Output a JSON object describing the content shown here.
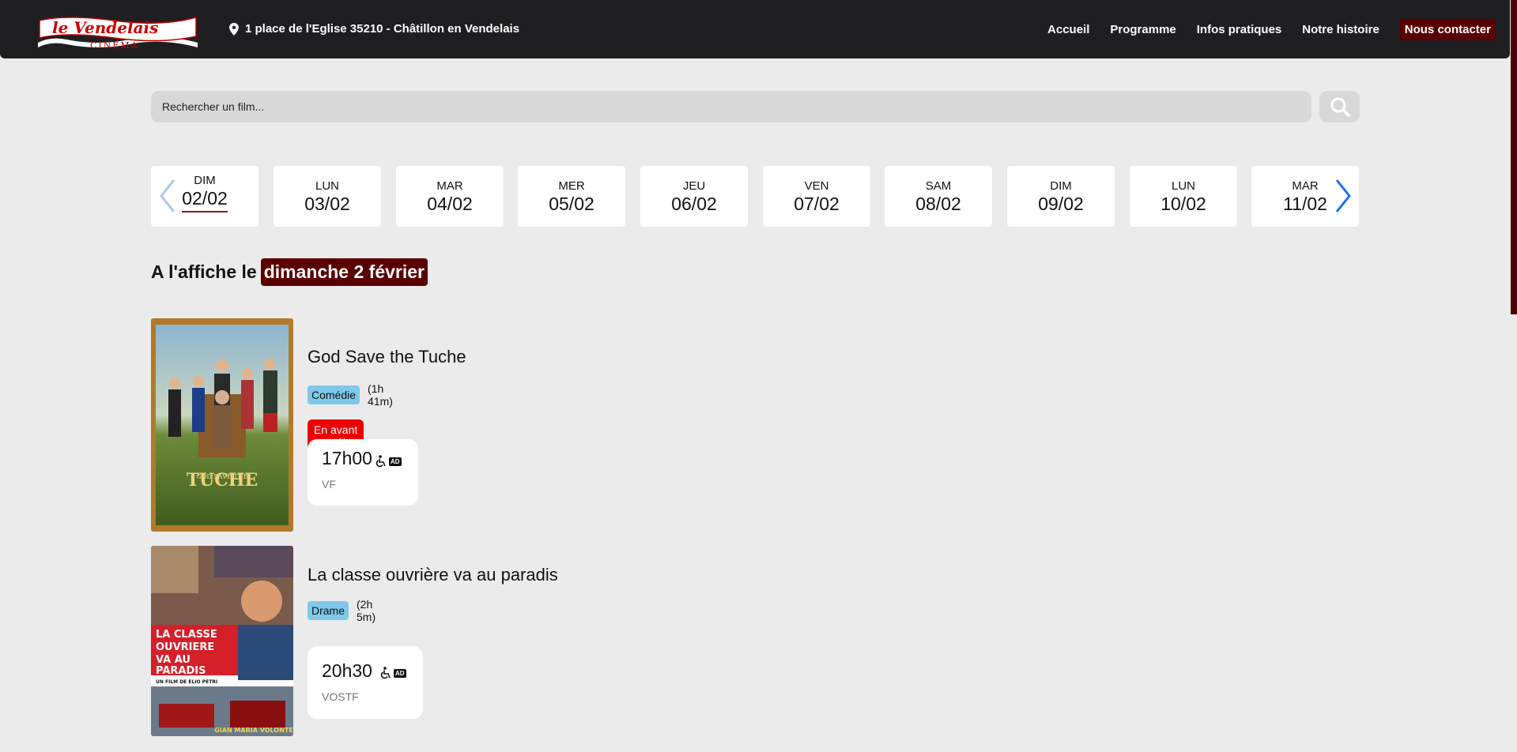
{
  "header": {
    "logo_alt": "Le Vendelais Cinema",
    "address": "1 place de l'Eglise 35210 - Châtillon en Vendelais",
    "nav": [
      "Accueil",
      "Programme",
      "Infos pratiques",
      "Notre histoire",
      "Nous contacter"
    ]
  },
  "search": {
    "placeholder": "Rechercher un film..."
  },
  "dates": [
    {
      "dow": "DIM",
      "dm": "02/02",
      "active": true
    },
    {
      "dow": "LUN",
      "dm": "03/02"
    },
    {
      "dow": "MAR",
      "dm": "04/02"
    },
    {
      "dow": "MER",
      "dm": "05/02"
    },
    {
      "dow": "JEU",
      "dm": "06/02"
    },
    {
      "dow": "VEN",
      "dm": "07/02"
    },
    {
      "dow": "SAM",
      "dm": "08/02"
    },
    {
      "dow": "DIM",
      "dm": "09/02"
    },
    {
      "dow": "LUN",
      "dm": "10/02"
    },
    {
      "dow": "MAR",
      "dm": "11/02"
    }
  ],
  "showing": {
    "prefix": "A l'affiche le",
    "date": "dimanche 2 février"
  },
  "films": [
    {
      "title": "God Save the Tuche",
      "genre": "Comédie",
      "duration": "(1h 41m)",
      "badge": "En avant première",
      "session": {
        "time": "17h00",
        "lang": "VF",
        "ad": "AD"
      },
      "poster_text": "TUCHE"
    },
    {
      "title": "La classe ouvrière va au paradis",
      "genre": "Drame",
      "duration": "(2h 5m)",
      "session": {
        "time": "20h30",
        "lang": "VOSTF",
        "ad": "AD"
      },
      "poster_text": "LA CLASSE OUVRIERE VA AU PARADIS"
    }
  ],
  "colors": {
    "header_bg": "#1f1f22",
    "accent": "#5a0000",
    "genre": "#7ec8ea",
    "premiere": "#ee0000"
  }
}
